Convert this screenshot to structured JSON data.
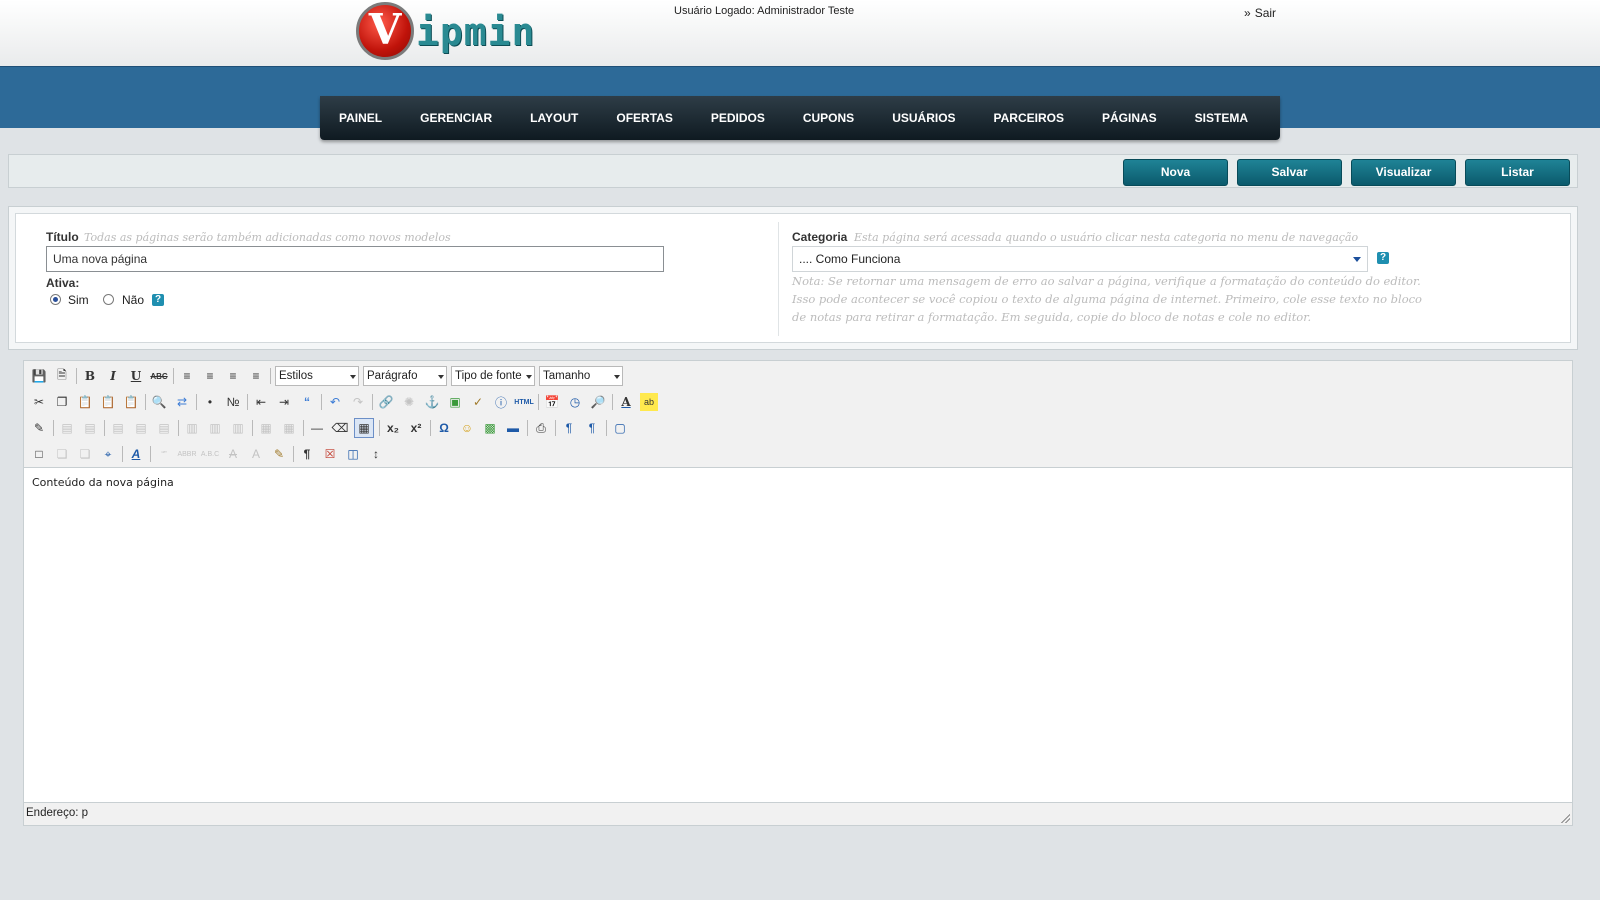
{
  "header": {
    "logo_letter": "V",
    "logo_text": "ipmin",
    "user_logged": "Usuário Logado: Administrador Teste",
    "logout_label": "Sair",
    "logout_arrow": "»"
  },
  "nav": {
    "items": [
      "PAINEL",
      "GERENCIAR",
      "LAYOUT",
      "OFERTAS",
      "PEDIDOS",
      "CUPONS",
      "USUÁRIOS",
      "PARCEIROS",
      "PÁGINAS",
      "SISTEMA"
    ]
  },
  "actions": {
    "new_label": "Nova",
    "save_label": "Salvar",
    "preview_label": "Visualizar",
    "list_label": "Listar"
  },
  "form": {
    "title_label": "Título",
    "title_hint": "Todas as páginas serão também adicionadas como novos modelos",
    "title_value": "Uma nova página",
    "active_label": "Ativa:",
    "yes_label": "Sim",
    "no_label": "Não",
    "active_selected": "Sim",
    "category_label": "Categoria",
    "category_hint": "Esta página será acessada quando o usuário clicar nesta categoria no menu de navegação",
    "category_value": ".... Como Funciona",
    "note": "Nota: Se retornar uma mensagem de erro ao salvar a página, verifique a formatação do conteúdo do editor.  Isso pode acontecer se você copiou o texto de alguma página de internet.  Primeiro, cole esse texto no bloco de notas para retirar a formatação.  Em seguida, copie do bloco de notas e cole no editor."
  },
  "editor": {
    "styles_dropdown": "Estilos",
    "format_dropdown": "Parágrafo",
    "font_dropdown": "Tipo de fonte",
    "size_dropdown": "Tamanho",
    "content": "Conteúdo da nova página",
    "path_label": "Endereço: p"
  },
  "colors": {
    "nav_bg": "#17232b",
    "header_blue": "#2d6a98",
    "button": "#0f6c80",
    "page_bg": "#dfe3e6"
  }
}
